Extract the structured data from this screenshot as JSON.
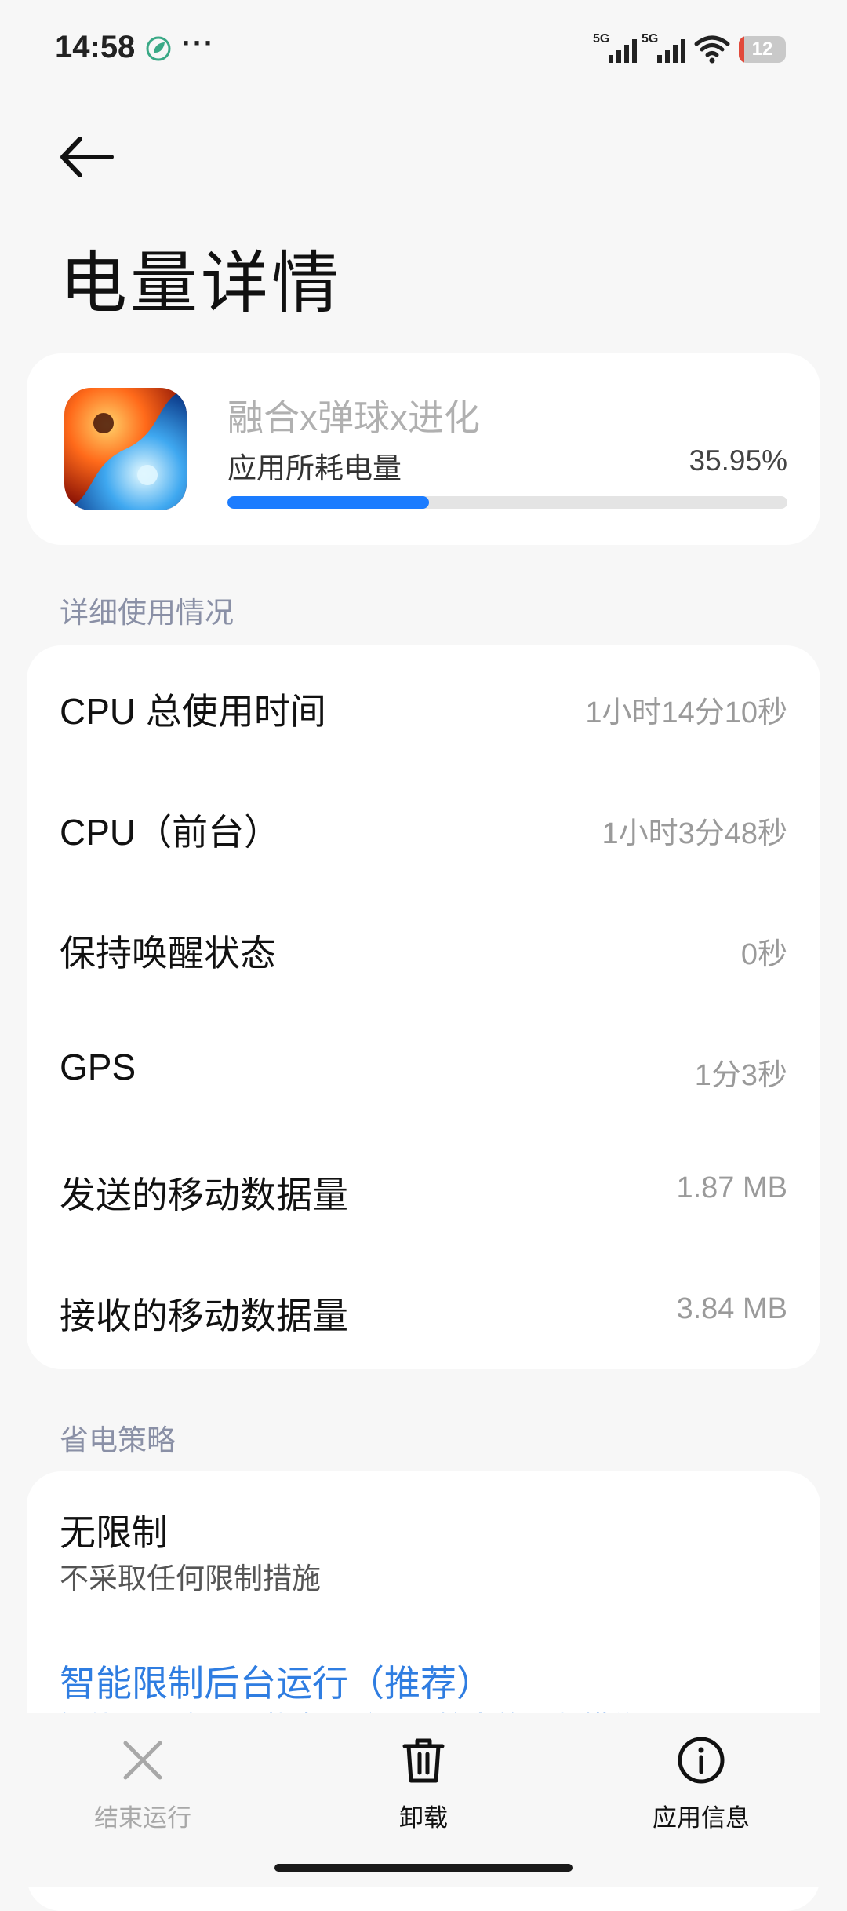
{
  "status_bar": {
    "time": "14:58",
    "leaf_icon": "leaf-icon",
    "more": "···",
    "signal1_label": "5G",
    "signal2_label": "5G",
    "battery_level": "12",
    "battery_color": "#e24a3b"
  },
  "header": {
    "title": "电量详情",
    "back_icon": "arrow-left-icon"
  },
  "app": {
    "name": "融合x弹球x进化",
    "usage_label": "应用所耗电量",
    "usage_value": "35.95%",
    "usage_fraction": 0.3595,
    "accent_color": "#1b7cff"
  },
  "details": {
    "section_title": "详细使用情况",
    "rows": [
      {
        "label": "CPU 总使用时间",
        "value": "1小时14分10秒"
      },
      {
        "label": "CPU（前台）",
        "value": "1小时3分48秒"
      },
      {
        "label": "保持唤醒状态",
        "value": "0秒"
      },
      {
        "label": "GPS",
        "value": "1分3秒"
      },
      {
        "label": "发送的移动数据量",
        "value": "1.87 MB"
      },
      {
        "label": "接收的移动数据量",
        "value": "3.84 MB"
      }
    ]
  },
  "policy": {
    "section_title": "省电策略",
    "option1_title": "无限制",
    "option1_sub": "不采取任何限制措施",
    "option2_title": "智能限制后台运行（推荐）",
    "option2_sub": "智能识别应用及状态，并采取恰当的限制措施"
  },
  "bottom_bar": {
    "items": [
      {
        "label": "结束运行",
        "icon": "close-icon"
      },
      {
        "label": "卸载",
        "icon": "trash-icon"
      },
      {
        "label": "应用信息",
        "icon": "info-icon"
      }
    ]
  }
}
